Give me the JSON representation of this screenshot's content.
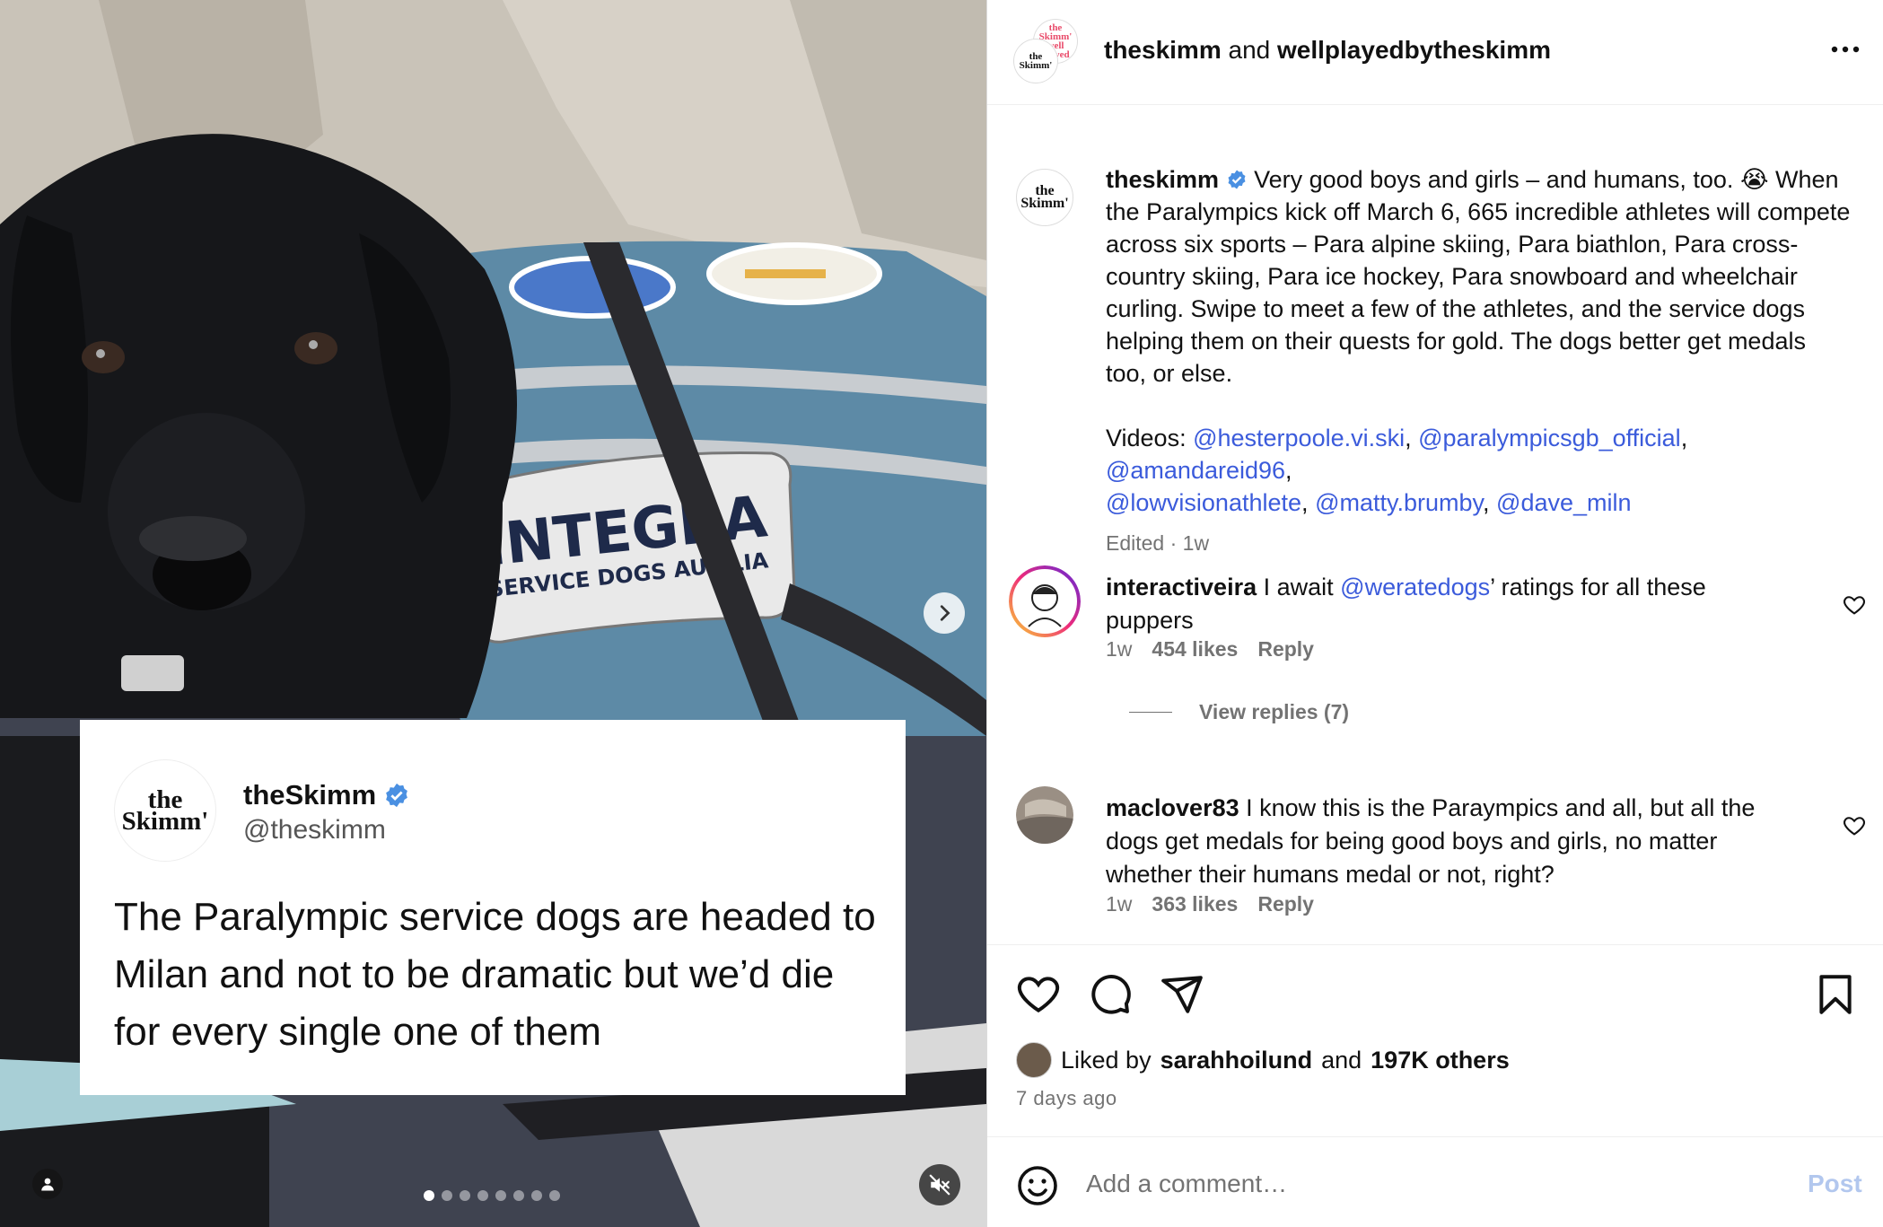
{
  "media": {
    "vest_patch_line1": "INTEGRA",
    "vest_patch_line2": "SERVICE DOGS AUS  LIA",
    "tweet": {
      "avatar_text": "the Skimm'",
      "name": "theSkimm",
      "handle": "@theskimm",
      "text": "The Paralympic service dogs are headed to Milan and not to be dramatic but we’d die for every single one of them"
    },
    "carousel_total": 8,
    "carousel_active": 0
  },
  "header": {
    "author": "theskimm",
    "joiner": "and",
    "collaborator": "wellplayedbytheskimm",
    "avatar1_text": "the Skimm' well played",
    "avatar2_text": "the Skimm'"
  },
  "caption": {
    "avatar_text": "the Skimm'",
    "username": "theskimm",
    "text": "Very good boys and girls – and humans, too. 😭 When the Paralympics kick off March 6, 665 incredible athletes will compete across six sports – Para alpine skiing, Para biathlon, Para cross-country skiing, Para ice hockey, Para snowboard and wheelchair curling. Swipe to meet a few of the athletes, and the service dogs helping them on their quests for gold. The dogs better get medals too, or else.",
    "videos_label": "Videos:",
    "mentions": [
      "@hesterpoole.vi.ski",
      "@paralympicsgb_official",
      "@amandareid96",
      "@lowvisionathlete",
      "@matty.brumby",
      "@dave_miln"
    ],
    "separator": ",",
    "meta": "Edited · 1w"
  },
  "comments": [
    {
      "username": "interactiveira",
      "text_before": "I await",
      "mention": "@weratedogs",
      "text_after": "’ ratings for all these puppers",
      "time": "1w",
      "likes": "454 likes",
      "reply": "Reply",
      "view_replies": "View replies (7)"
    },
    {
      "username": "maclover83",
      "text": "I know this is the Paraympics and all, but all the dogs get medals for being good boys and girls, no matter whether their humans medal or not, right?",
      "time": "1w",
      "likes": "363 likes",
      "reply": "Reply"
    }
  ],
  "likes": {
    "prefix": "Liked by",
    "user": "sarahhoilund",
    "joiner": "and",
    "others": "197K others",
    "date": "7 days ago"
  },
  "add_comment": {
    "placeholder": "Add a comment…",
    "post_label": "Post"
  },
  "colors": {
    "mention": "#3b5bdb",
    "verified": "#4a90e2",
    "muted": "#737373",
    "post_disabled": "#b2c7ee"
  },
  "icons": [
    "chevron-right-icon",
    "user-tag-icon",
    "muted-speaker-icon",
    "more-options-icon",
    "verified-icon",
    "heart-icon",
    "comment-icon",
    "share-icon",
    "bookmark-icon",
    "emoji-icon"
  ]
}
